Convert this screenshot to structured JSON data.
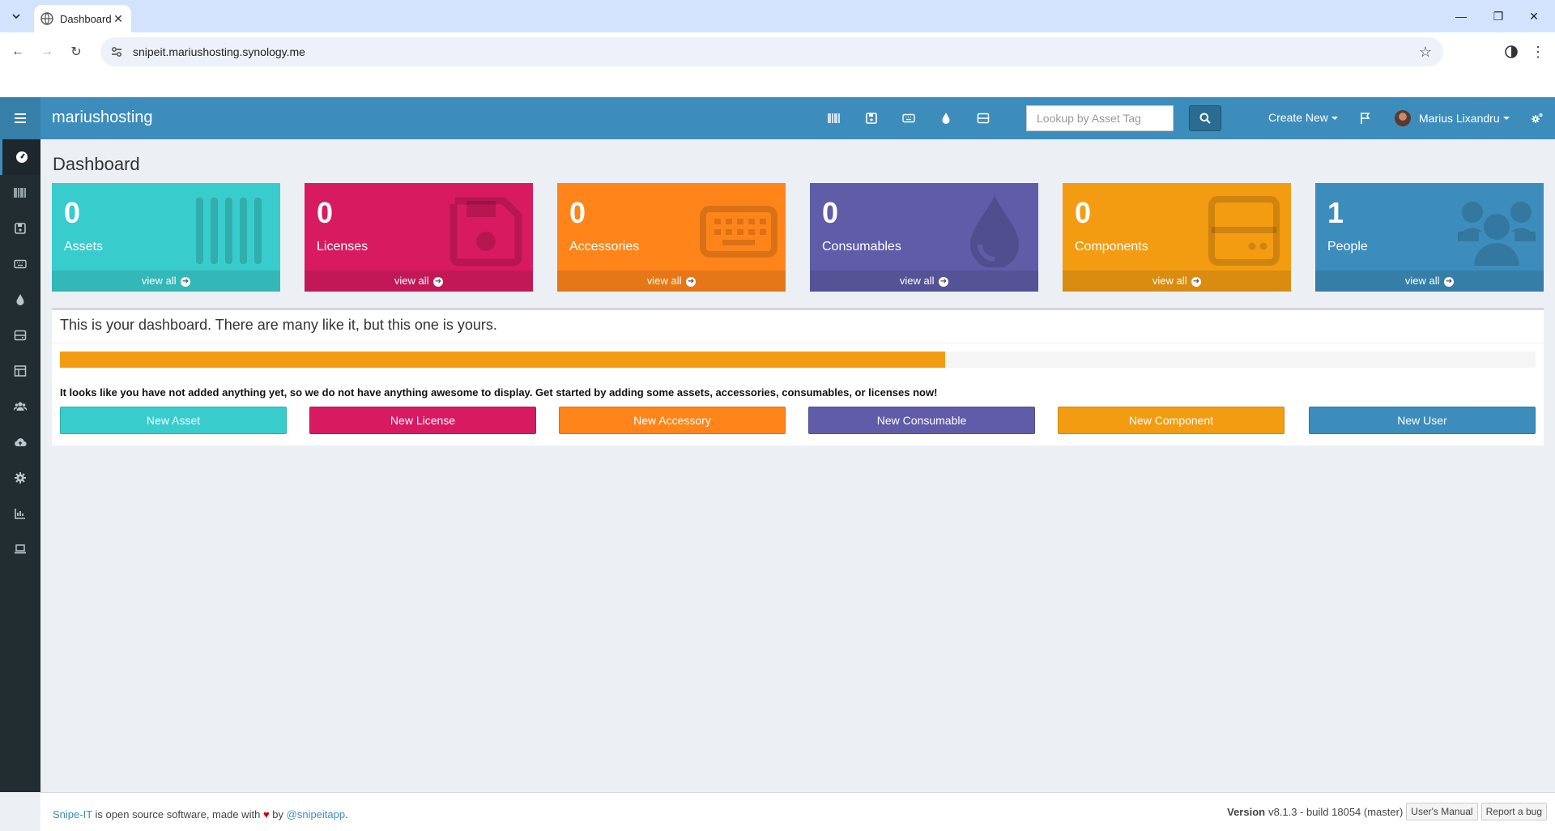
{
  "browser": {
    "tab_title": "Dashboard",
    "url": "snipeit.mariushosting.synology.me"
  },
  "header": {
    "brand": "mariushosting",
    "lookup_placeholder": "Lookup by Asset Tag",
    "create_new": "Create New",
    "user_name": "Marius Lixandru"
  },
  "page_title": "Dashboard",
  "tiles": [
    {
      "count": "0",
      "label": "Assets",
      "footer": "view all",
      "color": "#39cccc",
      "icon": "barcode-icon"
    },
    {
      "count": "0",
      "label": "Licenses",
      "footer": "view all",
      "color": "#d81b60",
      "icon": "floppy-icon"
    },
    {
      "count": "0",
      "label": "Accessories",
      "footer": "view all",
      "color": "#ff851b",
      "icon": "keyboard-icon"
    },
    {
      "count": "0",
      "label": "Consumables",
      "footer": "view all",
      "color": "#605ca8",
      "icon": "droplet-icon"
    },
    {
      "count": "0",
      "label": "Components",
      "footer": "view all",
      "color": "#f39c12",
      "icon": "hdd-icon"
    },
    {
      "count": "1",
      "label": "People",
      "footer": "view all",
      "color": "#3c8dbc",
      "icon": "users-icon"
    }
  ],
  "intro": {
    "title": "This is your dashboard. There are many like it, but this one is yours.",
    "progress_percent": 60,
    "notice": "It looks like you have not added anything yet, so we do not have anything awesome to display. Get started by adding some assets, accessories, consumables, or licenses now!"
  },
  "actions": [
    {
      "label": "New Asset",
      "color": "#39cccc"
    },
    {
      "label": "New License",
      "color": "#d81b60"
    },
    {
      "label": "New Accessory",
      "color": "#ff851b"
    },
    {
      "label": "New Consumable",
      "color": "#605ca8"
    },
    {
      "label": "New Component",
      "color": "#f39c12"
    },
    {
      "label": "New User",
      "color": "#3c8dbc"
    }
  ],
  "footer": {
    "app_name": "Snipe-IT",
    "text1": "is open source software, made with",
    "text2": "by",
    "handle": "@snipeitapp",
    "version_label": "Version",
    "version_value": "v8.1.3 - build 18054 (master)",
    "manual": "User's Manual",
    "report": "Report a bug"
  }
}
